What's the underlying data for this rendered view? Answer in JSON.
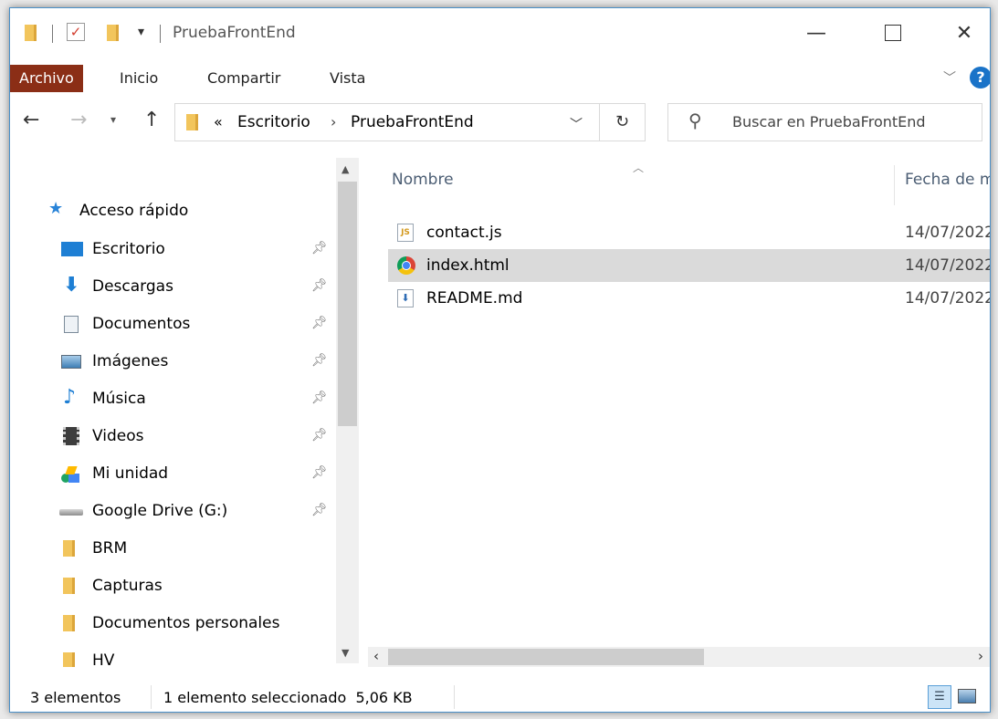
{
  "window": {
    "title": "PruebaFrontEnd",
    "accent": "#8b2e16"
  },
  "ribbon": {
    "tabs": [
      "Archivo",
      "Inicio",
      "Compartir",
      "Vista"
    ],
    "help": "?"
  },
  "navigation": {
    "breadcrumb_overflow": "«",
    "breadcrumb": [
      "Escritorio",
      "PruebaFrontEnd"
    ],
    "search_placeholder": "Buscar en PruebaFrontEnd"
  },
  "sidebar": {
    "quick_access": "Acceso rápido",
    "items": [
      {
        "label": "Escritorio",
        "icon": "desktop-icon",
        "pinned": true
      },
      {
        "label": "Descargas",
        "icon": "download-icon",
        "pinned": true
      },
      {
        "label": "Documentos",
        "icon": "documents-icon",
        "pinned": true
      },
      {
        "label": "Imágenes",
        "icon": "pictures-icon",
        "pinned": true
      },
      {
        "label": "Música",
        "icon": "music-icon",
        "pinned": true
      },
      {
        "label": "Videos",
        "icon": "videos-icon",
        "pinned": true
      },
      {
        "label": "Mi unidad",
        "icon": "google-drive-icon",
        "pinned": true
      },
      {
        "label": "Google Drive (G:)",
        "icon": "drive-icon",
        "pinned": true
      },
      {
        "label": "BRM",
        "icon": "folder-icon",
        "pinned": false
      },
      {
        "label": "Capturas",
        "icon": "folder-icon",
        "pinned": false
      },
      {
        "label": "Documentos personales",
        "icon": "folder-icon",
        "pinned": false
      },
      {
        "label": "HV",
        "icon": "folder-icon",
        "pinned": false
      }
    ]
  },
  "files": {
    "columns": [
      "Nombre",
      "Fecha de m"
    ],
    "rows": [
      {
        "name": "contact.js",
        "date": "14/07/2022",
        "icon": "js-file-icon",
        "selected": false
      },
      {
        "name": "index.html",
        "date": "14/07/2022",
        "icon": "chrome-icon",
        "selected": true
      },
      {
        "name": "README.md",
        "date": "14/07/2022",
        "icon": "md-file-icon",
        "selected": false
      }
    ]
  },
  "status": {
    "count": "3 elementos",
    "selection": "1 elemento seleccionado  5,06 KB"
  }
}
